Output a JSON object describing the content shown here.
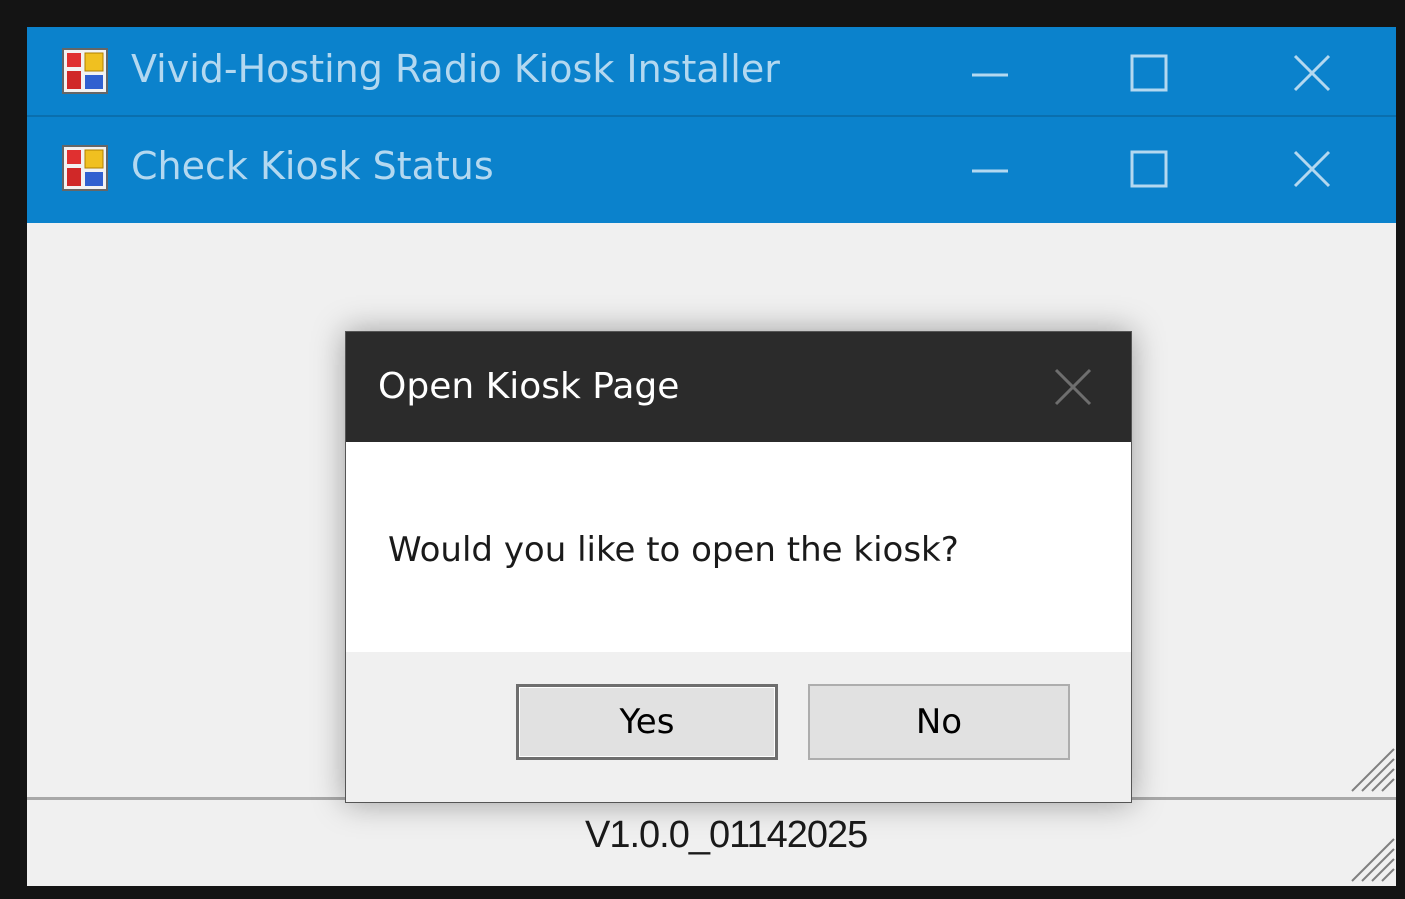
{
  "windows": [
    {
      "title": "Vivid-Hosting Radio Kiosk Installer"
    },
    {
      "title": "Check Kiosk Status"
    }
  ],
  "footer": {
    "version": "V1.0.0_01142025"
  },
  "dialog": {
    "title": "Open Kiosk Page",
    "message": "Would you like to open the kiosk?",
    "yes_label": "Yes",
    "no_label": "No"
  },
  "colors": {
    "titlebar": "#0b82cc",
    "dialog_titlebar": "#2b2b2b",
    "background": "#f0f0f0"
  }
}
